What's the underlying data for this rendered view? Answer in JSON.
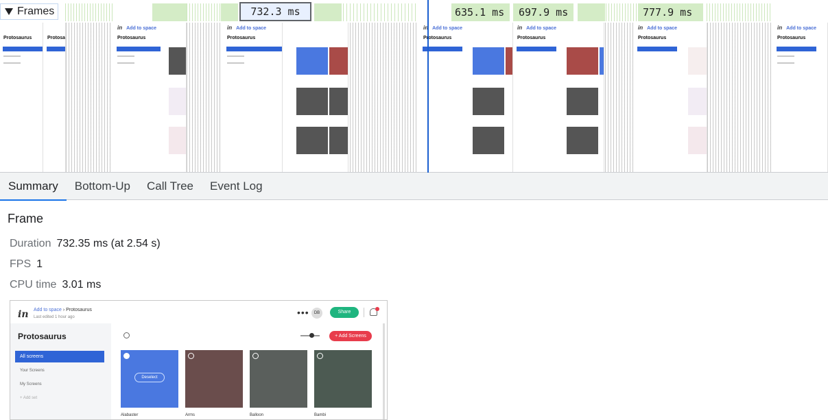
{
  "frames_track": {
    "title": "Frames",
    "selected_frame": "732.3 ms",
    "frame_labels": [
      "635.1 ms",
      "697.9 ms",
      "777.9 ms"
    ]
  },
  "filmstrip": {
    "app_title": "Protosaurus",
    "crumb": "Add to space",
    "selected_item": "All screens"
  },
  "tabs": [
    "Summary",
    "Bottom-Up",
    "Call Tree",
    "Event Log"
  ],
  "summary": {
    "title": "Frame",
    "rows": [
      {
        "key": "Duration",
        "value": "732.35 ms (at 2.54 s)"
      },
      {
        "key": "FPS",
        "value": "1"
      },
      {
        "key": "CPU time",
        "value": "3.01 ms"
      }
    ]
  },
  "preview": {
    "crumb_link": "Add to space",
    "crumb_current": "Protosaurus",
    "edited": "Last edited 1 hour ago",
    "avatar": "DB",
    "share": "Share",
    "title": "Protosaurus",
    "sidebar": [
      "All screens",
      "Your Screens",
      "My Screens",
      "Add set"
    ],
    "add_button": "Add Screens",
    "deselect": "Deselect",
    "cards": [
      "Alabaster",
      "Arms",
      "Balloon",
      "Bambi"
    ]
  },
  "colors": {
    "accent": "#1a73e8",
    "frame_green": "#d4ecc6",
    "invision_blue": "#2f64d6",
    "share_green": "#1fb57f",
    "add_red": "#e83c4c"
  }
}
